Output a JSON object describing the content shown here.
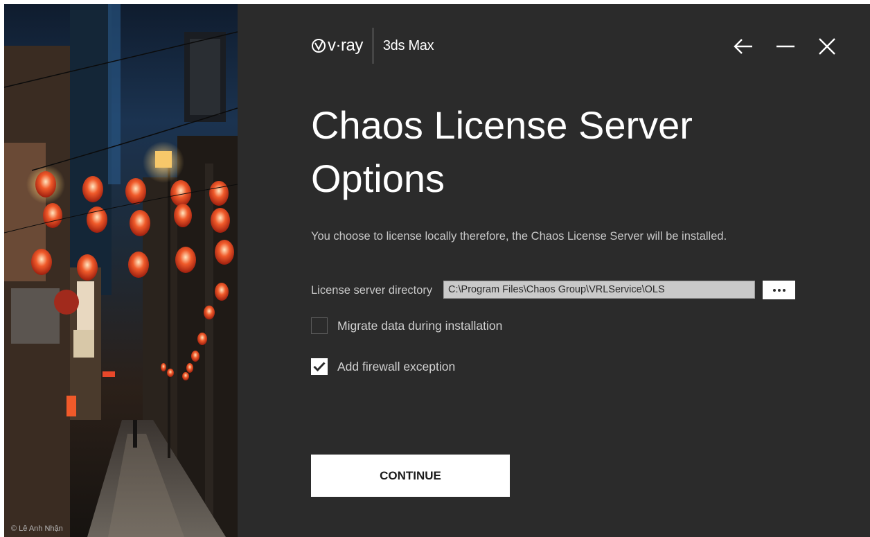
{
  "photo": {
    "description_icon": "night-street-lanterns-photo",
    "credit": "© Lê Anh Nhận"
  },
  "header": {
    "brand_logo_text": "v·ray",
    "product": "3ds Max",
    "back_icon": "arrow-left-icon",
    "minimize_icon": "minimize-icon",
    "close_icon": "close-icon"
  },
  "main": {
    "title": "Chaos License Server Options",
    "info": "You choose to license locally therefore, the Chaos License Server will be installed.",
    "directory_label": "License server directory",
    "directory_value": "C:\\Program Files\\Chaos Group\\VRLService\\OLS",
    "browse_icon": "more-dots-icon",
    "options": [
      {
        "label": "Migrate data during installation",
        "checked": false
      },
      {
        "label": "Add firewall exception",
        "checked": true
      }
    ],
    "continue_label": "CONTINUE"
  },
  "colors": {
    "background": "#2b2b2b",
    "text_primary": "#ffffff",
    "text_secondary": "#c8c8c8",
    "input_background": "#c9c9c9",
    "button_background": "#ffffff"
  }
}
